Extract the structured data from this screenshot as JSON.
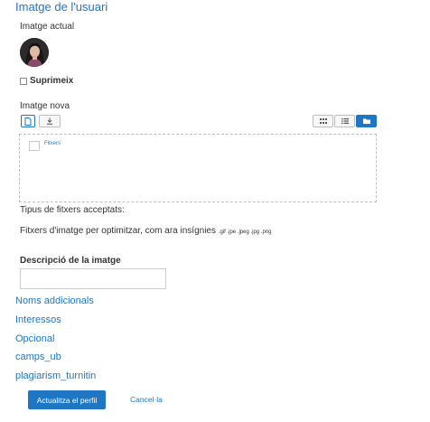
{
  "section_title": "Imatge de l'usuari",
  "current_image": {
    "label": "Imatge actual",
    "delete_label": "Suprimeix"
  },
  "new_image": {
    "label": "Imatge nova",
    "files_label": "Fitxers",
    "accepted_types_label": "Tipus de fitxers acceptats:",
    "accepted_types_desc": "Fitxers d'imatge per optimitzar, com ara insígnies",
    "accepted_types_ext": ".gif .jpe .jpeg .jpg .png"
  },
  "description": {
    "label": "Descripció de la imatge",
    "value": ""
  },
  "collapsed_sections": [
    "Noms addicionals",
    "Interessos",
    "Opcional",
    "camps_ub",
    "plagiarism_turnitin"
  ],
  "buttons": {
    "update": "Actualitza el perfil",
    "cancel": "Cancel·la"
  },
  "colors": {
    "accent": "#1f76c2"
  },
  "icons": {
    "add_file": "file-icon",
    "download": "download-icon",
    "view_grid": "grid-icon",
    "view_list": "list-icon",
    "view_folder": "folder-icon"
  }
}
